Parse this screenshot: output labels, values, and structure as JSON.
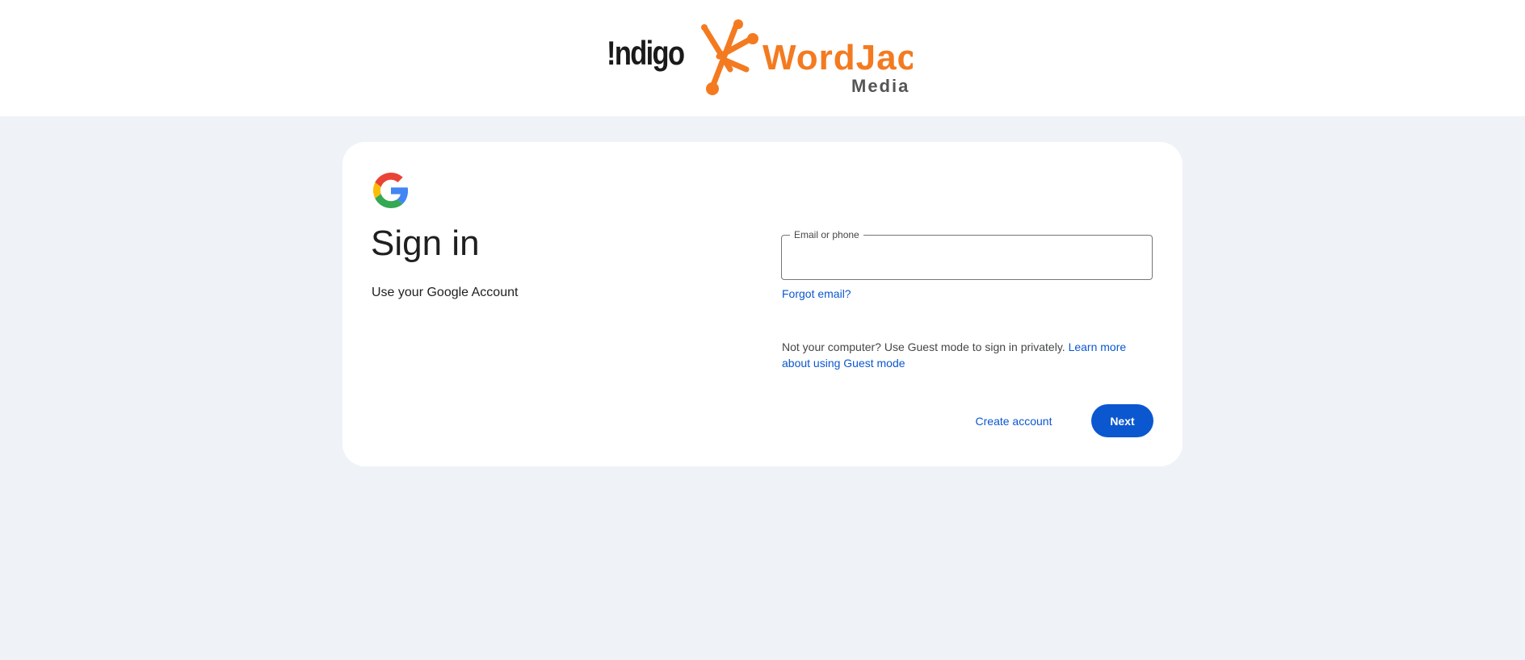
{
  "header": {
    "logos": [
      "Indigo",
      "WordJack Media"
    ]
  },
  "signin": {
    "title": "Sign in",
    "subtitle": "Use your Google Account",
    "email_label": "Email or phone",
    "email_value": "",
    "forgot_email": "Forgot email?",
    "guest_text": "Not your computer? Use Guest mode to sign in privately.",
    "guest_link": "Learn more about using Guest mode",
    "create_account": "Create account",
    "next": "Next"
  },
  "colors": {
    "page_bg": "#eff3f8",
    "card_bg": "#ffffff",
    "accent": "#0b57d0",
    "wordjack_orange": "#f47a20",
    "wordjack_gray": "#555555"
  },
  "icons": [
    "google-g-icon"
  ]
}
